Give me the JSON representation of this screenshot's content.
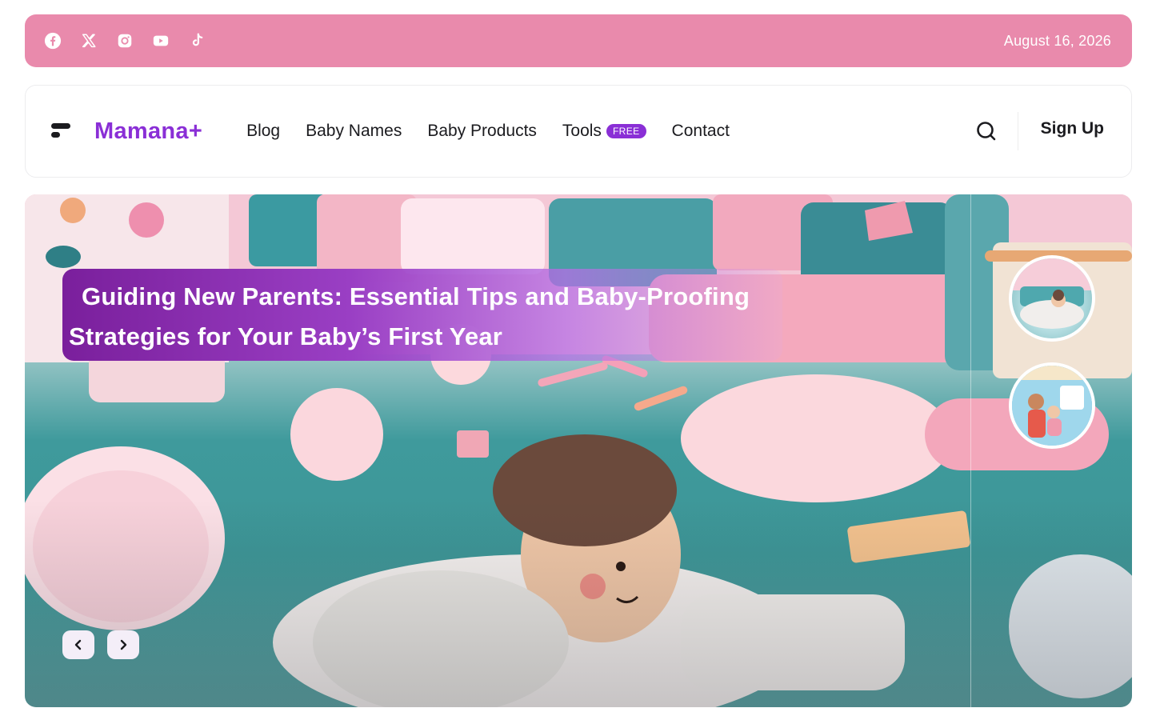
{
  "topbar": {
    "socials": [
      {
        "icon": "facebook-icon"
      },
      {
        "icon": "x-twitter-icon"
      },
      {
        "icon": "instagram-icon"
      },
      {
        "icon": "youtube-icon"
      },
      {
        "icon": "tiktok-icon"
      }
    ],
    "date": "August 16, 2026",
    "bg_color": "#e98aac"
  },
  "header": {
    "logo_text": "Mamana+",
    "brand_color": "#8a2fd6",
    "nav": [
      {
        "label": "Blog"
      },
      {
        "label": "Baby Names"
      },
      {
        "label": "Baby Products"
      },
      {
        "label": "Tools",
        "badge": "FREE"
      },
      {
        "label": "Contact"
      }
    ],
    "signup_label": "Sign Up"
  },
  "hero": {
    "headline": "Guiding New Parents: Essential Tips and Baby-Proofing Strategies for Your Baby’s First Year"
  }
}
